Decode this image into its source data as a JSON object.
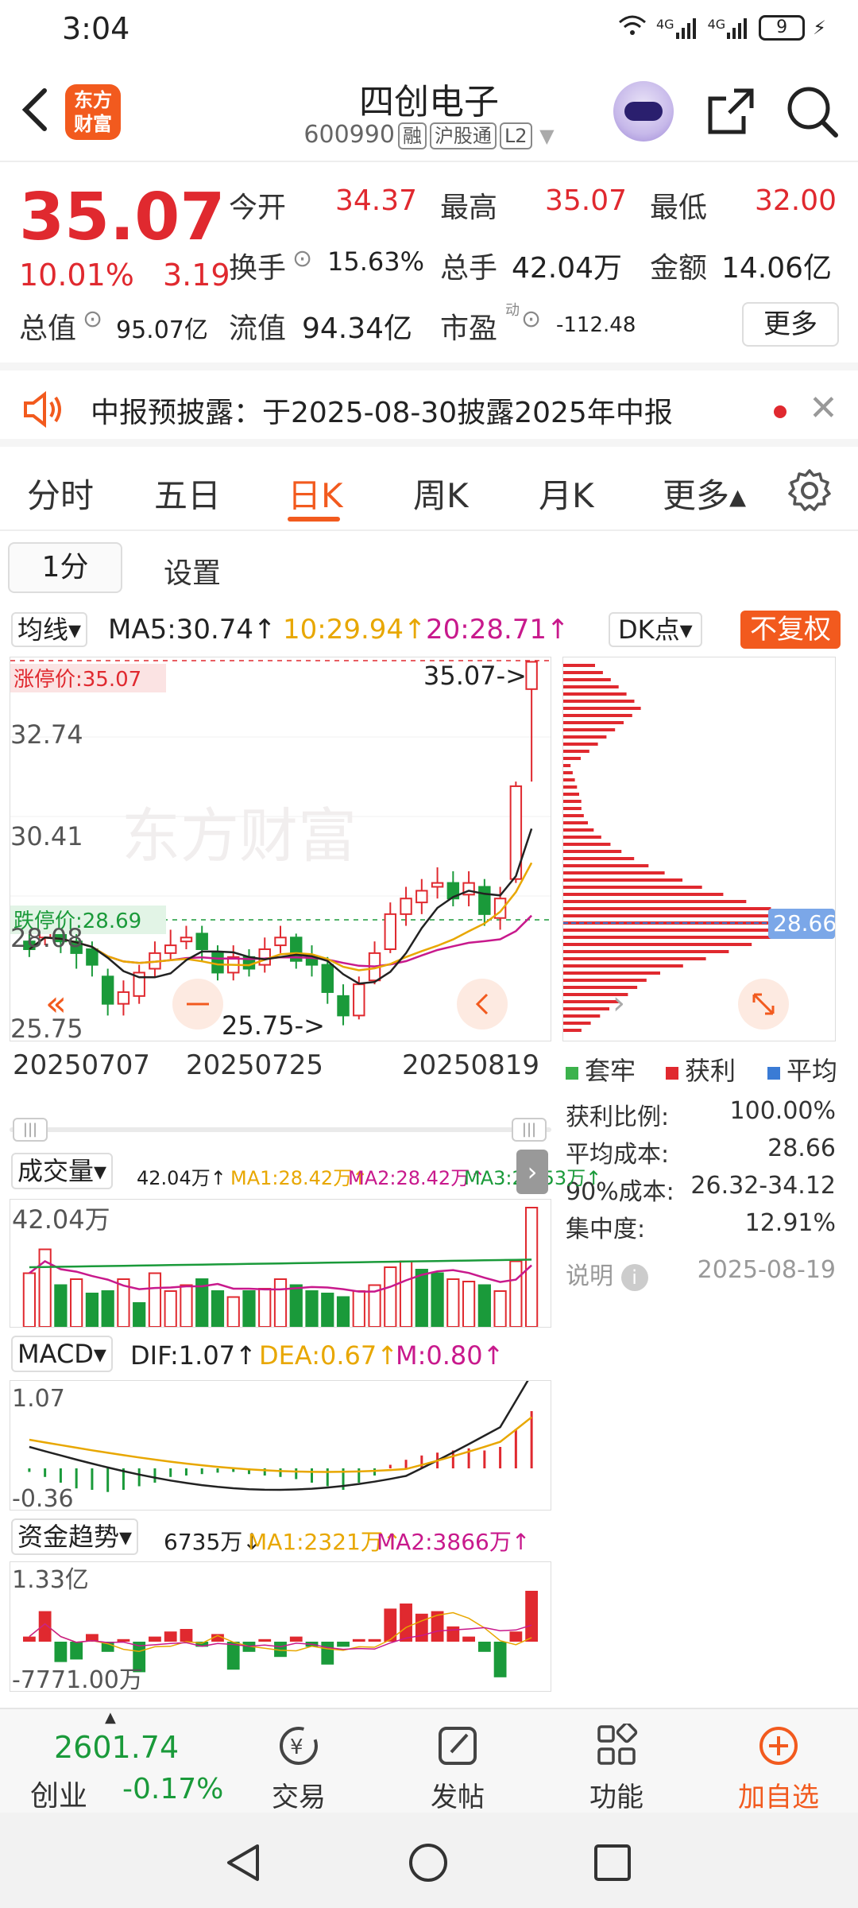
{
  "status": {
    "time": "3:04",
    "net1": "4G",
    "net2": "4G",
    "battery": "9"
  },
  "header": {
    "logo_line1": "东方",
    "logo_line2": "财富",
    "name": "四创电子",
    "code": "600990",
    "tags": [
      "融",
      "沪股通",
      "L2"
    ]
  },
  "quote": {
    "price": "35.07",
    "change_pct": "10.01%",
    "change_amt": "3.19",
    "open_label": "今开",
    "open": "34.37",
    "high_label": "最高",
    "high": "35.07",
    "low_label": "最低",
    "low": "32.00",
    "turnover_label": "换手",
    "turnover": "15.63%",
    "volume_label": "总手",
    "volume": "42.04万",
    "amount_label": "金额",
    "amount": "14.06亿",
    "mcap_label": "总值",
    "mcap": "95.07亿",
    "float_label": "流值",
    "float": "94.34亿",
    "pe_label": "市盈",
    "pe_sup": "动",
    "pe": "-112.48",
    "more": "更多"
  },
  "notice": {
    "text": "中报预披露：于2025-08-30披露2025年中报"
  },
  "tabs": [
    "分时",
    "五日",
    "日K",
    "周K",
    "月K",
    "更多▴"
  ],
  "subtabs": {
    "period": "1分",
    "settings": "设置"
  },
  "ma": {
    "selector": "均线▾",
    "ma5": "MA5:30.74↑",
    "ma10": "10:29.94↑",
    "ma20": "20:28.71↑",
    "dk": "DK点▾",
    "adjust": "不复权",
    "colors": {
      "ma5": "#222222",
      "ma10": "#e8a700",
      "ma20": "#c8198c"
    }
  },
  "kchart": {
    "limit_up": "涨停价:35.07",
    "limit_down": "跌停价:28.69",
    "y_top": "32.74",
    "y_mid": "30.41",
    "y_low": "28.08",
    "y_min": "25.75",
    "max_marker": "35.07->",
    "min_marker": "25.75->",
    "watermark": "东方财富",
    "dates": [
      "20250707",
      "20250725",
      "20250819"
    ]
  },
  "chip": {
    "avg_price": "28.66",
    "legend": [
      "套牢",
      "获利",
      "平均"
    ],
    "stats": [
      {
        "label": "获利比例:",
        "value": "100.00%"
      },
      {
        "label": "平均成本:",
        "value": "28.66"
      },
      {
        "label": "90%成本:",
        "value": "26.32-34.12"
      },
      {
        "label": "集中度:",
        "value": "12.91%"
      }
    ],
    "note_label": "说明",
    "date": "2025-08-19"
  },
  "volume": {
    "selector": "成交量▾",
    "val": "42.04万↑",
    "ma1": "MA1:28.42万↑",
    "ma2": "MA2:28.42万↑",
    "ma3": "MA3:20.53万↑",
    "axis_max": "42.04万"
  },
  "macd": {
    "selector": "MACD▾",
    "dif": "DIF:1.07↑",
    "dea": "DEA:0.67↑",
    "m": "M:0.80↑",
    "axis_max": "1.07",
    "axis_min": "-0.36"
  },
  "fund": {
    "selector": "资金趋势▾",
    "val": "6735万↓",
    "ma1": "MA1:2321万↑",
    "ma2": "MA2:3866万↑",
    "axis_max": "1.33亿",
    "axis_min": "-7771.00万"
  },
  "bottom": {
    "index_value": "2601.74",
    "index_name": "创业",
    "index_change": "-0.17%",
    "trade": "交易",
    "post": "发帖",
    "functions": "功能",
    "add_watch": "加自选"
  }
}
